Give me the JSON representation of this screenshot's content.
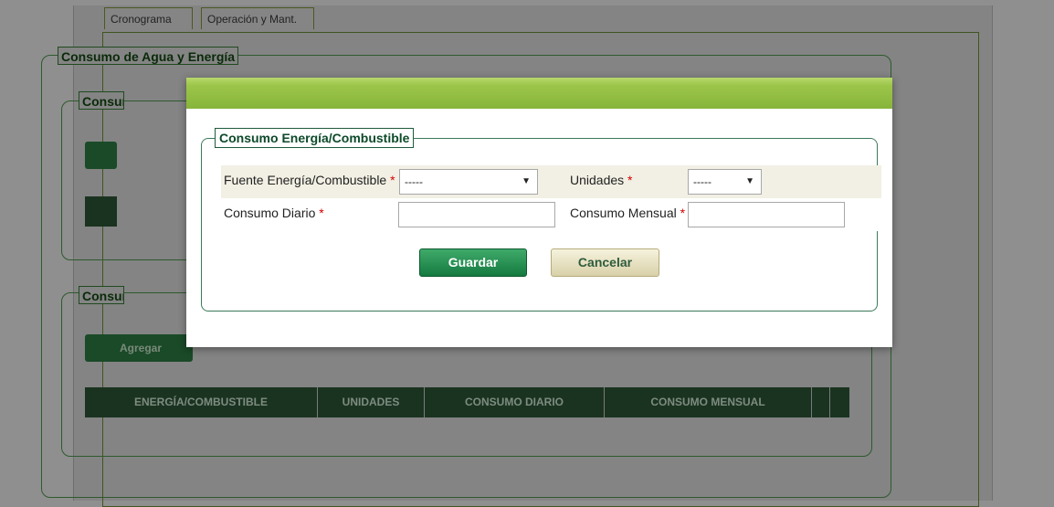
{
  "tabs": [
    {
      "label": "Cronograma"
    },
    {
      "label": "Operación y Mant."
    }
  ],
  "background": {
    "outer_legend": "Consumo de Agua y Energía",
    "inner_legend_1": "Consumo de Agua",
    "inner_legend_2": "Consumo Energía/Combustible",
    "add_button": "Agregar",
    "table_headers": [
      "ENERGÍA/COMBUSTIBLE",
      "UNIDADES",
      "CONSUMO DIARIO",
      "CONSUMO MENSUAL",
      "",
      ""
    ]
  },
  "modal": {
    "legend": "Consumo Energía/Combustible",
    "fields": {
      "fuente": {
        "label": "Fuente Energía/Combustible",
        "required_mark": "*",
        "value": "-----"
      },
      "unidades": {
        "label": "Unidades",
        "required_mark": "*",
        "value": "-----"
      },
      "consumo_diario": {
        "label": "Consumo Diario",
        "required_mark": "*",
        "value": ""
      },
      "consumo_mensual": {
        "label": "Consumo Mensual",
        "required_mark": "*",
        "value": ""
      }
    },
    "buttons": {
      "save": "Guardar",
      "cancel": "Cancelar"
    },
    "arrow_icon": "▼"
  },
  "colors": {
    "header_green": "#8ebc42",
    "save_green": "#1f8a4c",
    "cancel_beige": "#e8e2c0",
    "required_red": "#d40000"
  }
}
